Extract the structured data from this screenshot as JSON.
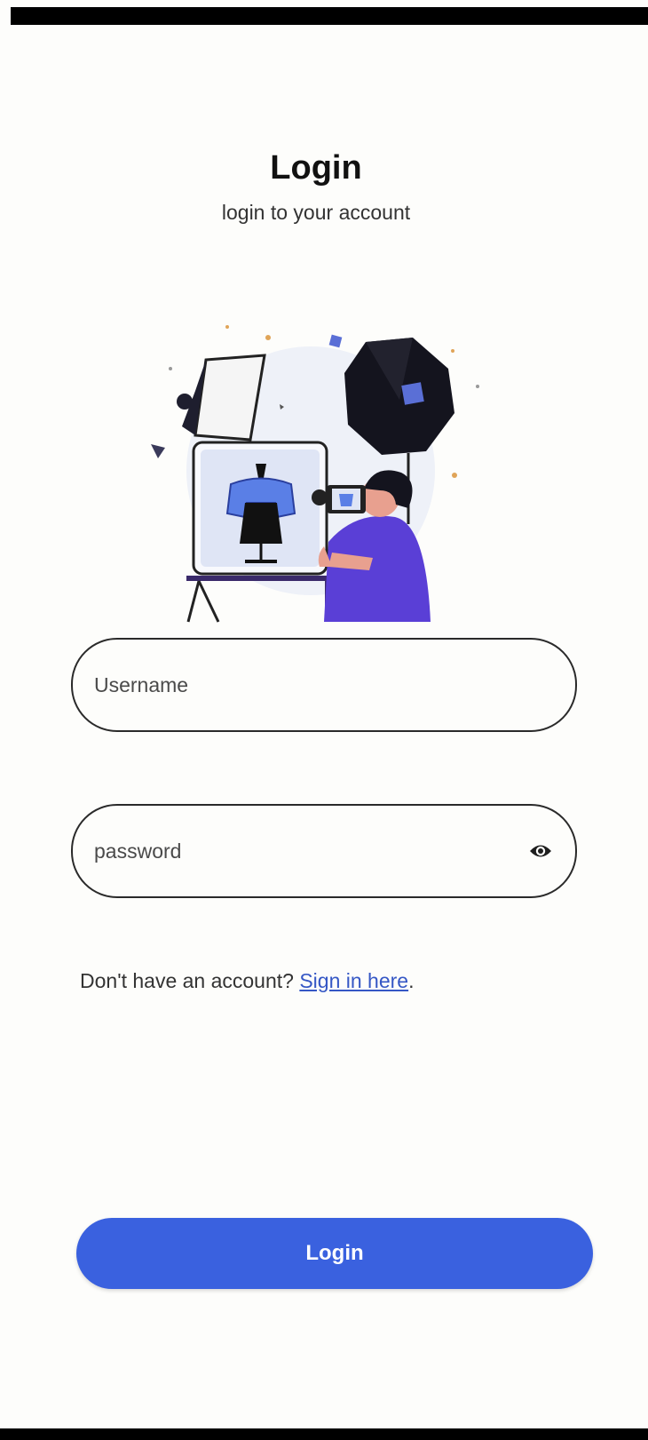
{
  "header": {
    "title": "Login",
    "subtitle": "login to your account"
  },
  "illustration": {
    "icon": "photographer-studio-illustration"
  },
  "form": {
    "username": {
      "placeholder": "Username",
      "value": ""
    },
    "password": {
      "placeholder": "password",
      "value": "",
      "toggle_icon": "eye-icon"
    }
  },
  "signup": {
    "prompt": "Don't have an account?",
    "link_label": "Sign in here",
    "trailing": "."
  },
  "login_button": {
    "label": "Login"
  },
  "colors": {
    "background": "#fdfdfb",
    "accent": "#3a61df",
    "link": "#3557c5",
    "illustration_primary": "#5a3fd6"
  }
}
